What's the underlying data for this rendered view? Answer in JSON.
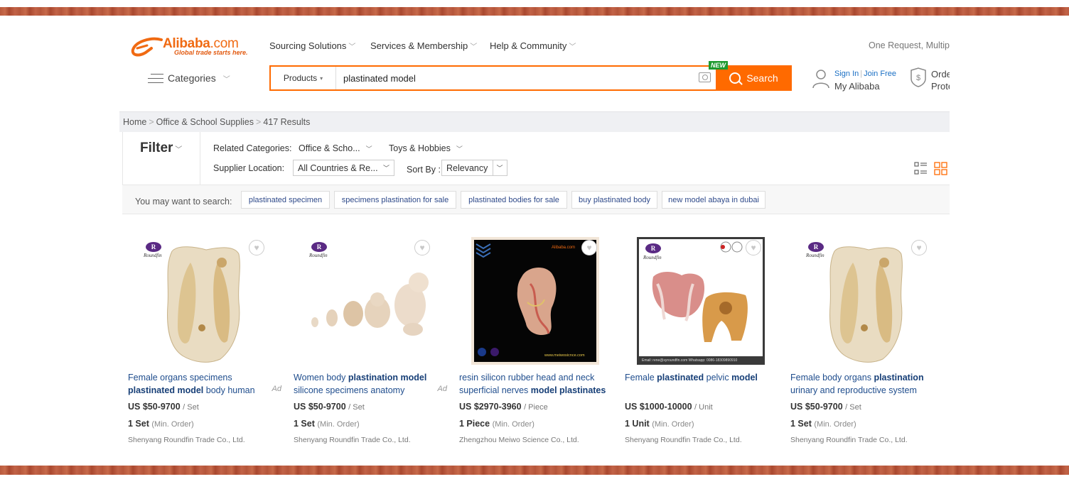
{
  "logo": {
    "brand": "Alibaba",
    "domain": ".com",
    "tagline": "Global trade starts here."
  },
  "topnav": [
    {
      "label": "Sourcing Solutions"
    },
    {
      "label": "Services & Membership"
    },
    {
      "label": "Help & Community"
    }
  ],
  "rfq_text": "One Request, Multipl",
  "categories_label": "Categories",
  "search": {
    "product_type": "Products",
    "query": "plastinated model",
    "new_badge": "NEW",
    "button_label": "Search"
  },
  "account": {
    "sign_in": "Sign In",
    "join_free": "Join Free",
    "my_alibaba": "My Alibaba",
    "order_line1": "Orde",
    "order_line2": "Prote"
  },
  "breadcrumb": {
    "home": "Home",
    "category": "Office & School Supplies",
    "results": "417 Results"
  },
  "filter": {
    "title": "Filter",
    "related_label": "Related Categories:",
    "related": [
      "Office & Scho...",
      "Toys & Hobbies"
    ],
    "supplier_label": "Supplier Location:",
    "supplier_value": "All Countries & Re...",
    "sort_label": "Sort By :",
    "sort_value": "Relevancy"
  },
  "suggestions": {
    "label": "You may want to search:",
    "tags": [
      "plastinated specimen",
      "specimens plastination for sale",
      "plastinated bodies for sale",
      "buy plastinated body",
      "new model abaya in dubai"
    ]
  },
  "products": [
    {
      "title_parts": [
        {
          "text": "Female organs specimens ",
          "bold": false
        },
        {
          "text": "plastinated model",
          "bold": true
        },
        {
          "text": " body human",
          "bold": false
        }
      ],
      "ad": "Ad",
      "price": "US $50-9700",
      "unit": "/ Set",
      "moq": "1 Set",
      "moq_note": "(Min. Order)",
      "seller": "Shenyang Roundfin Trade Co., Ltd.",
      "brand_mark": "Roundfin"
    },
    {
      "title_parts": [
        {
          "text": "Women body ",
          "bold": false
        },
        {
          "text": "plastination model",
          "bold": true
        },
        {
          "text": " silicone specimens anatomy",
          "bold": false
        }
      ],
      "ad": "Ad",
      "price": "US $50-9700",
      "unit": "/ Set",
      "moq": "1 Set",
      "moq_note": "(Min. Order)",
      "seller": "Shenyang Roundfin Trade Co., Ltd.",
      "brand_mark": "Roundfin"
    },
    {
      "title_parts": [
        {
          "text": "resin silicon rubber head and neck superficial nerves ",
          "bold": false
        },
        {
          "text": "model plastinates",
          "bold": true
        }
      ],
      "ad": "",
      "price": "US $2970-3960",
      "unit": "/ Piece",
      "moq": "1 Piece",
      "moq_note": "(Min. Order)",
      "seller": "Zhengzhou Meiwo Science Co., Ltd.",
      "brand_mark": "Alibaba.com",
      "image_footer": "www.meiwosicnce.com"
    },
    {
      "title_parts": [
        {
          "text": "Female ",
          "bold": false
        },
        {
          "text": "plastinated",
          "bold": true
        },
        {
          "text": " pelvic ",
          "bold": false
        },
        {
          "text": "model",
          "bold": true
        }
      ],
      "ad": "",
      "price": "US $1000-10000",
      "unit": "/ Unit",
      "moq": "1 Unit",
      "moq_note": "(Min. Order)",
      "seller": "Shenyang Roundfin Trade Co., Ltd.",
      "brand_mark": "Roundfin",
      "image_footer": "Email: rene@syroundfin.com Whatsapp: 0086-18309890910"
    },
    {
      "title_parts": [
        {
          "text": "Female body organs ",
          "bold": false
        },
        {
          "text": "plastination",
          "bold": true
        },
        {
          "text": " urinary and reproductive system",
          "bold": false
        }
      ],
      "ad": "",
      "price": "US $50-9700",
      "unit": "/ Set",
      "moq": "1 Set",
      "moq_note": "(Min. Order)",
      "seller": "Shenyang Roundfin Trade Co., Ltd.",
      "brand_mark": "Roundfin"
    }
  ],
  "colors": {
    "accent": "#ff6a00",
    "link": "#1f4d8d",
    "new_badge": "#1e9a2f",
    "band": "#b95a3e"
  }
}
